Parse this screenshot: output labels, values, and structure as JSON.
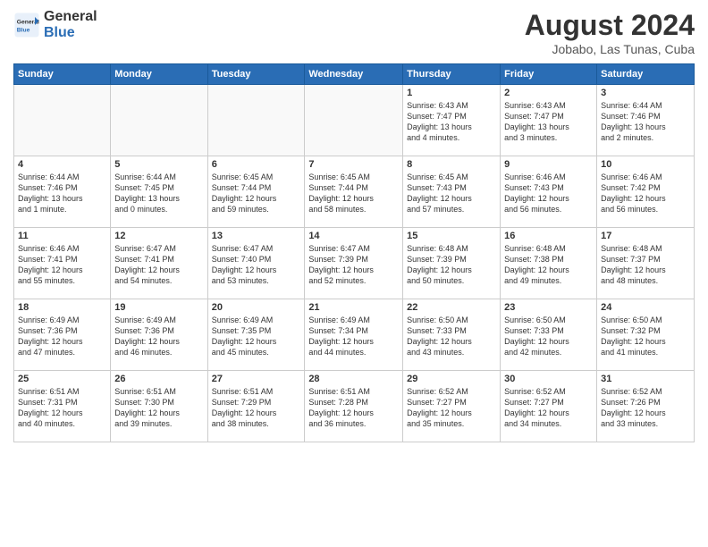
{
  "header": {
    "logo_general": "General",
    "logo_blue": "Blue",
    "month_year": "August 2024",
    "location": "Jobabo, Las Tunas, Cuba"
  },
  "weekdays": [
    "Sunday",
    "Monday",
    "Tuesday",
    "Wednesday",
    "Thursday",
    "Friday",
    "Saturday"
  ],
  "weeks": [
    [
      {
        "day": "",
        "info": ""
      },
      {
        "day": "",
        "info": ""
      },
      {
        "day": "",
        "info": ""
      },
      {
        "day": "",
        "info": ""
      },
      {
        "day": "1",
        "info": "Sunrise: 6:43 AM\nSunset: 7:47 PM\nDaylight: 13 hours\nand 4 minutes."
      },
      {
        "day": "2",
        "info": "Sunrise: 6:43 AM\nSunset: 7:47 PM\nDaylight: 13 hours\nand 3 minutes."
      },
      {
        "day": "3",
        "info": "Sunrise: 6:44 AM\nSunset: 7:46 PM\nDaylight: 13 hours\nand 2 minutes."
      }
    ],
    [
      {
        "day": "4",
        "info": "Sunrise: 6:44 AM\nSunset: 7:46 PM\nDaylight: 13 hours\nand 1 minute."
      },
      {
        "day": "5",
        "info": "Sunrise: 6:44 AM\nSunset: 7:45 PM\nDaylight: 13 hours\nand 0 minutes."
      },
      {
        "day": "6",
        "info": "Sunrise: 6:45 AM\nSunset: 7:44 PM\nDaylight: 12 hours\nand 59 minutes."
      },
      {
        "day": "7",
        "info": "Sunrise: 6:45 AM\nSunset: 7:44 PM\nDaylight: 12 hours\nand 58 minutes."
      },
      {
        "day": "8",
        "info": "Sunrise: 6:45 AM\nSunset: 7:43 PM\nDaylight: 12 hours\nand 57 minutes."
      },
      {
        "day": "9",
        "info": "Sunrise: 6:46 AM\nSunset: 7:43 PM\nDaylight: 12 hours\nand 56 minutes."
      },
      {
        "day": "10",
        "info": "Sunrise: 6:46 AM\nSunset: 7:42 PM\nDaylight: 12 hours\nand 56 minutes."
      }
    ],
    [
      {
        "day": "11",
        "info": "Sunrise: 6:46 AM\nSunset: 7:41 PM\nDaylight: 12 hours\nand 55 minutes."
      },
      {
        "day": "12",
        "info": "Sunrise: 6:47 AM\nSunset: 7:41 PM\nDaylight: 12 hours\nand 54 minutes."
      },
      {
        "day": "13",
        "info": "Sunrise: 6:47 AM\nSunset: 7:40 PM\nDaylight: 12 hours\nand 53 minutes."
      },
      {
        "day": "14",
        "info": "Sunrise: 6:47 AM\nSunset: 7:39 PM\nDaylight: 12 hours\nand 52 minutes."
      },
      {
        "day": "15",
        "info": "Sunrise: 6:48 AM\nSunset: 7:39 PM\nDaylight: 12 hours\nand 50 minutes."
      },
      {
        "day": "16",
        "info": "Sunrise: 6:48 AM\nSunset: 7:38 PM\nDaylight: 12 hours\nand 49 minutes."
      },
      {
        "day": "17",
        "info": "Sunrise: 6:48 AM\nSunset: 7:37 PM\nDaylight: 12 hours\nand 48 minutes."
      }
    ],
    [
      {
        "day": "18",
        "info": "Sunrise: 6:49 AM\nSunset: 7:36 PM\nDaylight: 12 hours\nand 47 minutes."
      },
      {
        "day": "19",
        "info": "Sunrise: 6:49 AM\nSunset: 7:36 PM\nDaylight: 12 hours\nand 46 minutes."
      },
      {
        "day": "20",
        "info": "Sunrise: 6:49 AM\nSunset: 7:35 PM\nDaylight: 12 hours\nand 45 minutes."
      },
      {
        "day": "21",
        "info": "Sunrise: 6:49 AM\nSunset: 7:34 PM\nDaylight: 12 hours\nand 44 minutes."
      },
      {
        "day": "22",
        "info": "Sunrise: 6:50 AM\nSunset: 7:33 PM\nDaylight: 12 hours\nand 43 minutes."
      },
      {
        "day": "23",
        "info": "Sunrise: 6:50 AM\nSunset: 7:33 PM\nDaylight: 12 hours\nand 42 minutes."
      },
      {
        "day": "24",
        "info": "Sunrise: 6:50 AM\nSunset: 7:32 PM\nDaylight: 12 hours\nand 41 minutes."
      }
    ],
    [
      {
        "day": "25",
        "info": "Sunrise: 6:51 AM\nSunset: 7:31 PM\nDaylight: 12 hours\nand 40 minutes."
      },
      {
        "day": "26",
        "info": "Sunrise: 6:51 AM\nSunset: 7:30 PM\nDaylight: 12 hours\nand 39 minutes."
      },
      {
        "day": "27",
        "info": "Sunrise: 6:51 AM\nSunset: 7:29 PM\nDaylight: 12 hours\nand 38 minutes."
      },
      {
        "day": "28",
        "info": "Sunrise: 6:51 AM\nSunset: 7:28 PM\nDaylight: 12 hours\nand 36 minutes."
      },
      {
        "day": "29",
        "info": "Sunrise: 6:52 AM\nSunset: 7:27 PM\nDaylight: 12 hours\nand 35 minutes."
      },
      {
        "day": "30",
        "info": "Sunrise: 6:52 AM\nSunset: 7:27 PM\nDaylight: 12 hours\nand 34 minutes."
      },
      {
        "day": "31",
        "info": "Sunrise: 6:52 AM\nSunset: 7:26 PM\nDaylight: 12 hours\nand 33 minutes."
      }
    ]
  ]
}
